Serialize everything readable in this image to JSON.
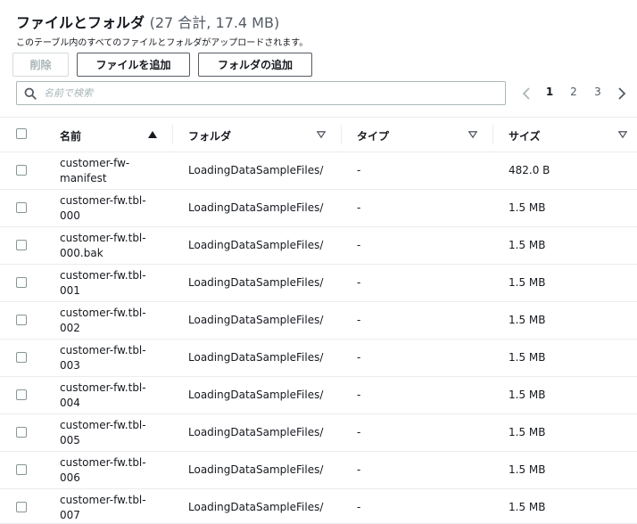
{
  "header": {
    "title": "ファイルとフォルダ",
    "count": "(27 合計, 17.4 MB)",
    "subtitle": "このテーブル内のすべてのファイルとフォルダがアップロードされます。"
  },
  "actions": {
    "delete_label": "削除",
    "add_files_label": "ファイルを追加",
    "add_folder_label": "フォルダの追加"
  },
  "search": {
    "placeholder": "名前で検索",
    "value": ""
  },
  "pagination": {
    "pages": [
      "1",
      "2",
      "3"
    ],
    "current": "1"
  },
  "table": {
    "columns": {
      "name": "名前",
      "folder": "フォルダ",
      "type": "タイプ",
      "size": "サイズ"
    },
    "rows": [
      {
        "name_line1": "customer-fw-",
        "name_line2": "manifest",
        "folder": "LoadingDataSampleFiles/",
        "type": "-",
        "size": "482.0 B"
      },
      {
        "name_line1": "customer-fw.tbl-",
        "name_line2": "000",
        "folder": "LoadingDataSampleFiles/",
        "type": "-",
        "size": "1.5 MB"
      },
      {
        "name_line1": "customer-fw.tbl-",
        "name_line2": "000.bak",
        "folder": "LoadingDataSampleFiles/",
        "type": "-",
        "size": "1.5 MB"
      },
      {
        "name_line1": "customer-fw.tbl-",
        "name_line2": "001",
        "folder": "LoadingDataSampleFiles/",
        "type": "-",
        "size": "1.5 MB"
      },
      {
        "name_line1": "customer-fw.tbl-",
        "name_line2": "002",
        "folder": "LoadingDataSampleFiles/",
        "type": "-",
        "size": "1.5 MB"
      },
      {
        "name_line1": "customer-fw.tbl-",
        "name_line2": "003",
        "folder": "LoadingDataSampleFiles/",
        "type": "-",
        "size": "1.5 MB"
      },
      {
        "name_line1": "customer-fw.tbl-",
        "name_line2": "004",
        "folder": "LoadingDataSampleFiles/",
        "type": "-",
        "size": "1.5 MB"
      },
      {
        "name_line1": "customer-fw.tbl-",
        "name_line2": "005",
        "folder": "LoadingDataSampleFiles/",
        "type": "-",
        "size": "1.5 MB"
      },
      {
        "name_line1": "customer-fw.tbl-",
        "name_line2": "006",
        "folder": "LoadingDataSampleFiles/",
        "type": "-",
        "size": "1.5 MB"
      },
      {
        "name_line1": "customer-fw.tbl-",
        "name_line2": "007",
        "folder": "LoadingDataSampleFiles/",
        "type": "-",
        "size": "1.5 MB"
      }
    ]
  },
  "icons": {
    "search": "search-icon",
    "sort_ascending": "caret-up-icon",
    "sort_unsorted": "caret-down-outline-icon",
    "prev_page": "chevron-left-icon",
    "next_page": "chevron-right-icon"
  },
  "colors": {
    "text": "#16191f",
    "muted": "#545b64",
    "disabled": "#aab7b8",
    "border": "#eaeded"
  }
}
